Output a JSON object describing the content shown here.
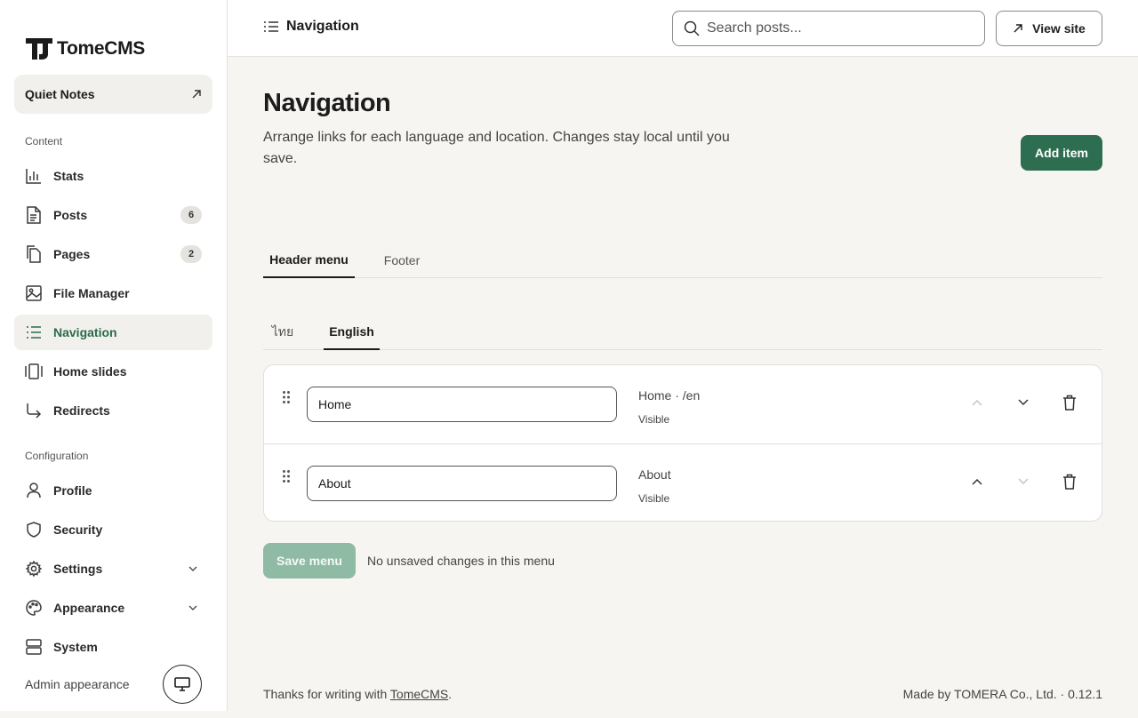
{
  "app": {
    "name": "TomeCMS"
  },
  "site": {
    "name": "Quiet Notes"
  },
  "sidebar": {
    "content_label": "Content",
    "config_label": "Configuration",
    "items": [
      {
        "label": "Stats",
        "icon": "chart-bar-icon"
      },
      {
        "label": "Posts",
        "icon": "document-icon",
        "badge": "6"
      },
      {
        "label": "Pages",
        "icon": "pages-icon",
        "badge": "2"
      },
      {
        "label": "File Manager",
        "icon": "image-icon"
      },
      {
        "label": "Navigation",
        "icon": "list-icon",
        "active": true
      },
      {
        "label": "Home slides",
        "icon": "slides-icon"
      },
      {
        "label": "Redirects",
        "icon": "redirect-arrow-icon"
      }
    ],
    "config_items": [
      {
        "label": "Profile",
        "icon": "user-icon"
      },
      {
        "label": "Security",
        "icon": "shield-icon"
      },
      {
        "label": "Settings",
        "icon": "gear-icon",
        "expandable": true
      },
      {
        "label": "Appearance",
        "icon": "palette-icon",
        "expandable": true
      },
      {
        "label": "System",
        "icon": "server-icon"
      }
    ],
    "admin_appearance": "Admin appearance"
  },
  "topbar": {
    "title": "Navigation",
    "search_placeholder": "Search posts...",
    "view_site": "View site"
  },
  "main": {
    "title": "Navigation",
    "description": "Arrange links for each language and location. Changes stay local until you save.",
    "add_item": "Add item",
    "location_tabs": [
      {
        "label": "Header menu",
        "active": true
      },
      {
        "label": "Footer",
        "active": false
      }
    ],
    "language_tabs": [
      {
        "label": "ไทย",
        "active": false
      },
      {
        "label": "English",
        "active": true
      }
    ],
    "menu_items": [
      {
        "label": "Home",
        "target": "Home · /en",
        "status": "Visible"
      },
      {
        "label": "About",
        "target": "About",
        "status": "Visible"
      }
    ],
    "save_menu": "Save menu",
    "save_status": "No unsaved changes in this menu"
  },
  "footer": {
    "left_prefix": "Thanks for writing with ",
    "left_link": "TomeCMS",
    "left_suffix": ".",
    "right": "Made by TOMERA Co., Ltd. · 0.12.1"
  },
  "colors": {
    "accent": "#2e6e50",
    "accent_disabled": "#8fbba5",
    "background": "#f6f5f2",
    "surface": "#ffffff"
  }
}
